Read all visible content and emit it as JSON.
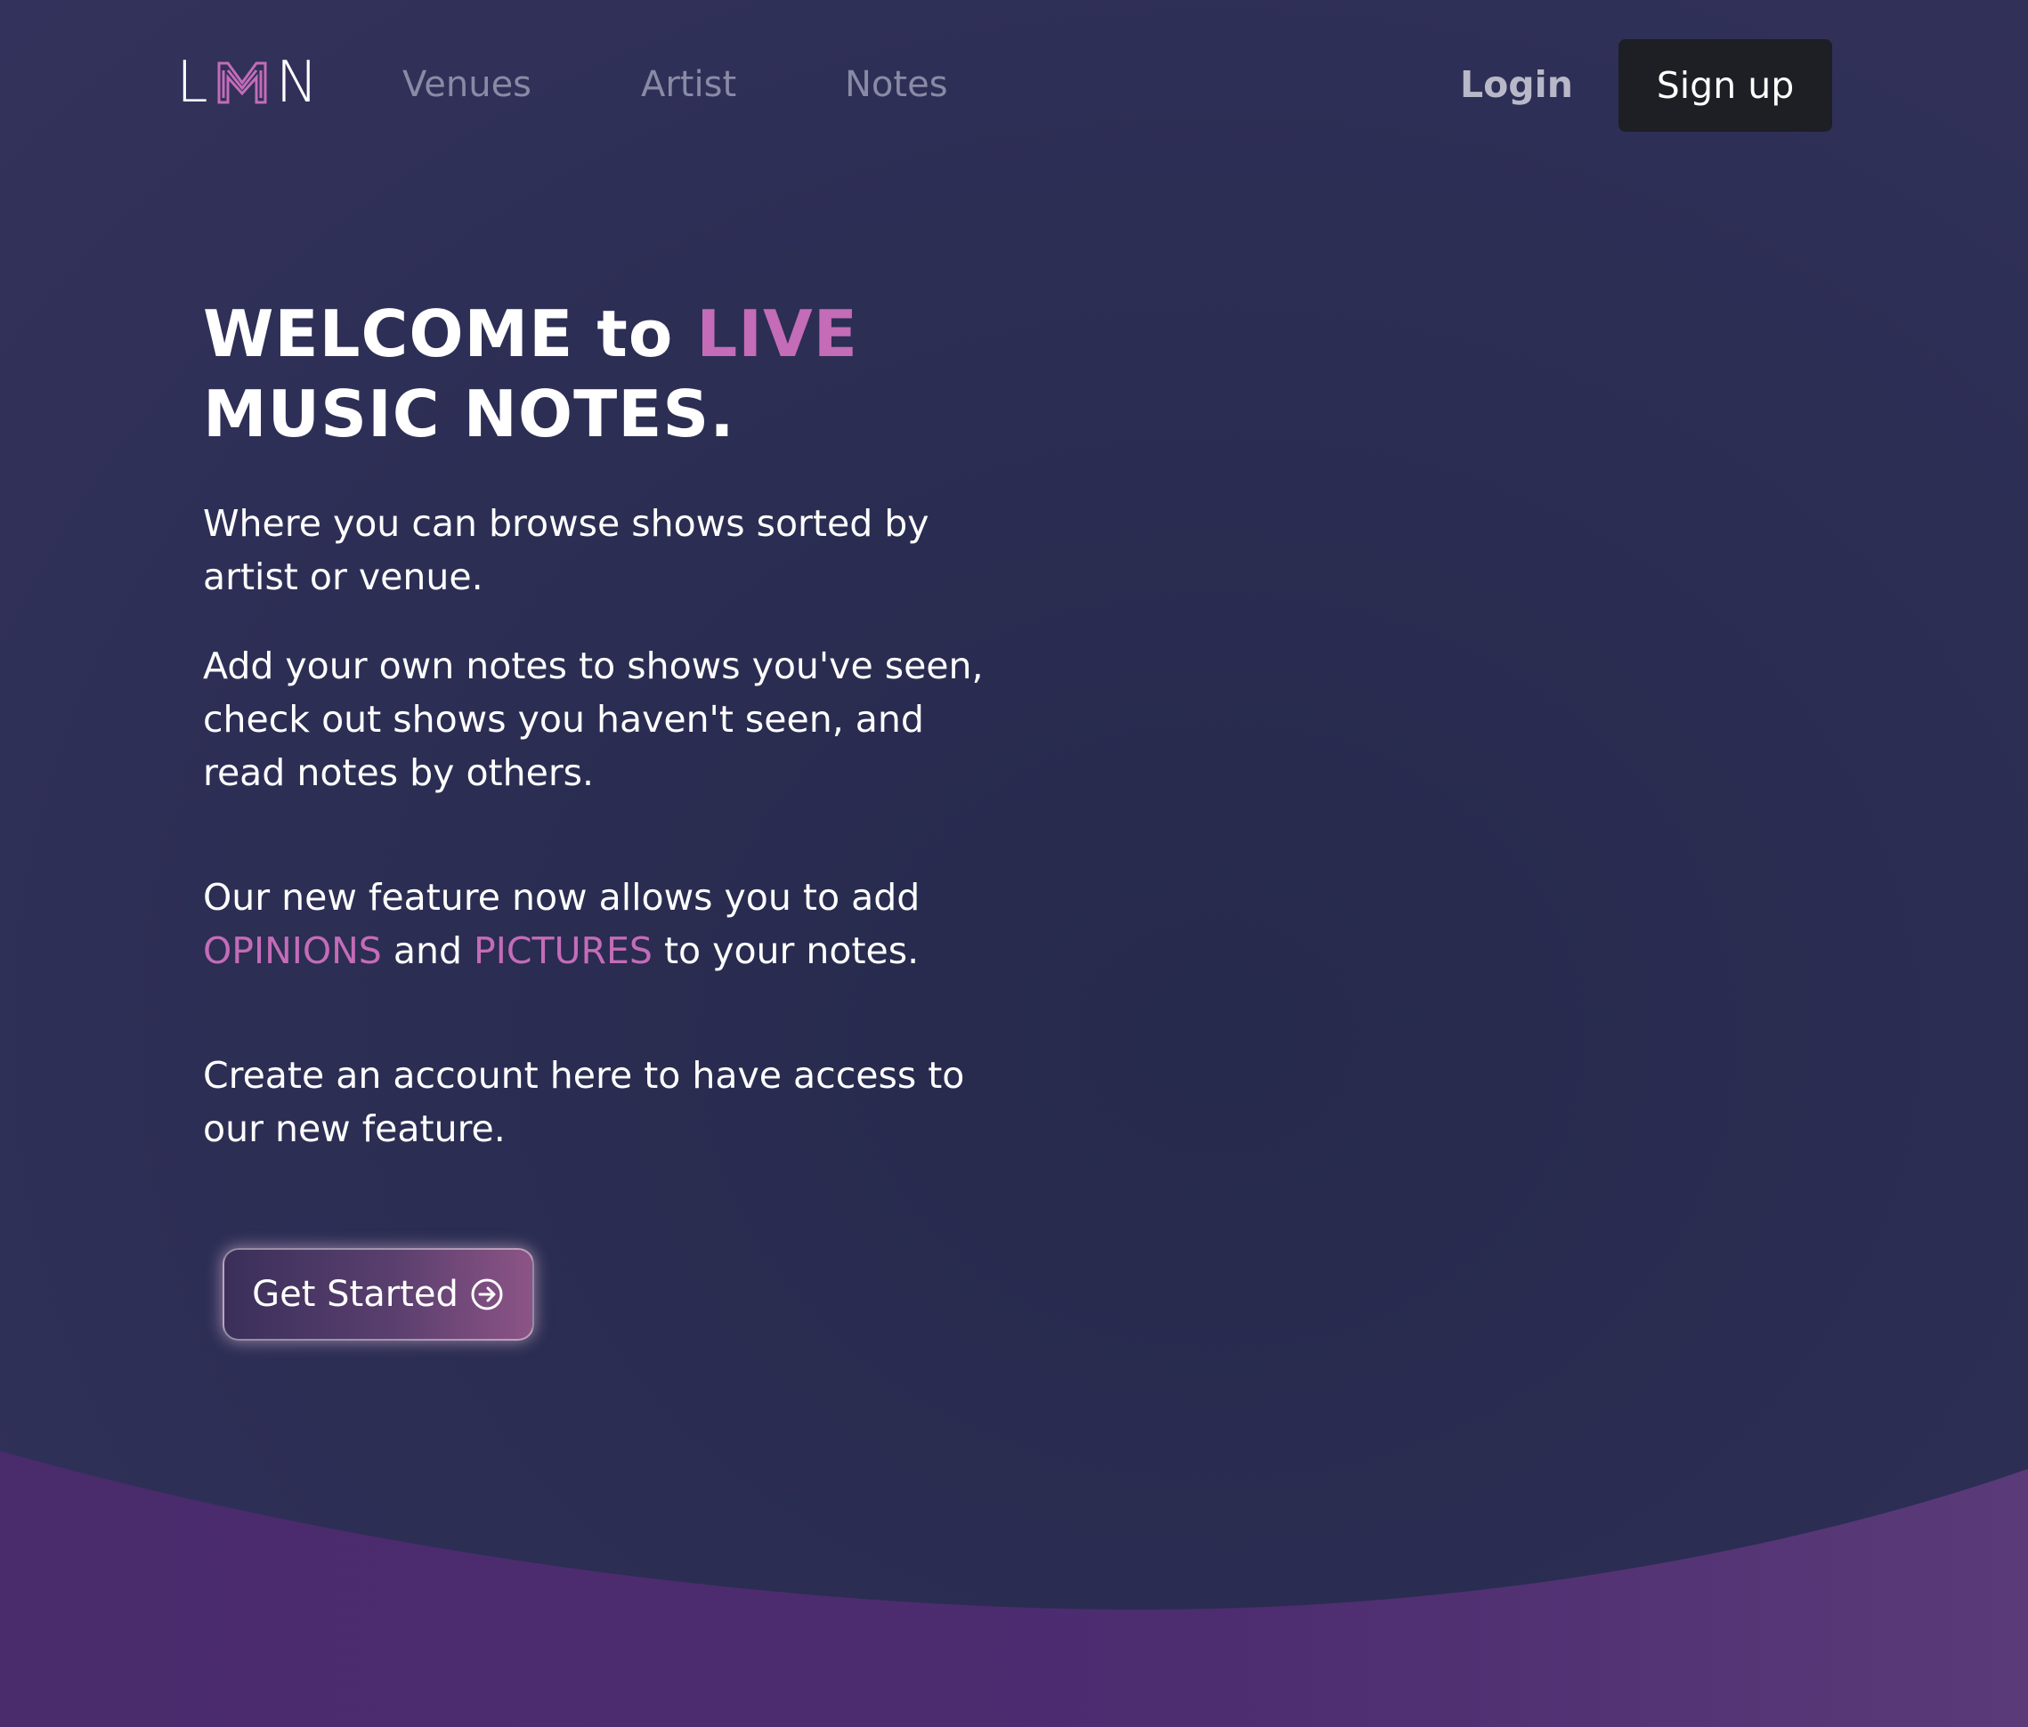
{
  "nav": {
    "logo": {
      "left_letter": "L",
      "right_letter": "N",
      "mark_icon": "lmn-logo-mark"
    },
    "links": [
      {
        "label": "Venues"
      },
      {
        "label": "Artist"
      },
      {
        "label": "Notes"
      }
    ],
    "login_label": "Login",
    "signup_label": "Sign up"
  },
  "hero": {
    "headline": {
      "part1": "WELCOME to ",
      "accent": "LIVE",
      "line2": "MUSIC NOTES."
    },
    "para1": [
      "Where you can browse shows sorted by",
      "artist or venue."
    ],
    "para2": [
      "Add your own notes to shows you've seen,",
      "check out shows you haven't seen, and",
      "read notes by others."
    ],
    "para3": {
      "line1": "Our new feature now allows you to add",
      "accent1": "OPINIONS",
      "mid": " and ",
      "accent2": "PICTURES",
      "end": " to your notes."
    },
    "para4": [
      "Create an account here to have access to",
      "our new feature."
    ],
    "cta_label": "Get Started",
    "cta_icon": "arrow-right-circle-icon"
  },
  "colors": {
    "accent": "#c46cb8",
    "background": "#2b2d52",
    "wave": "#4c2d6e",
    "signup_bg": "#1d1f24"
  }
}
